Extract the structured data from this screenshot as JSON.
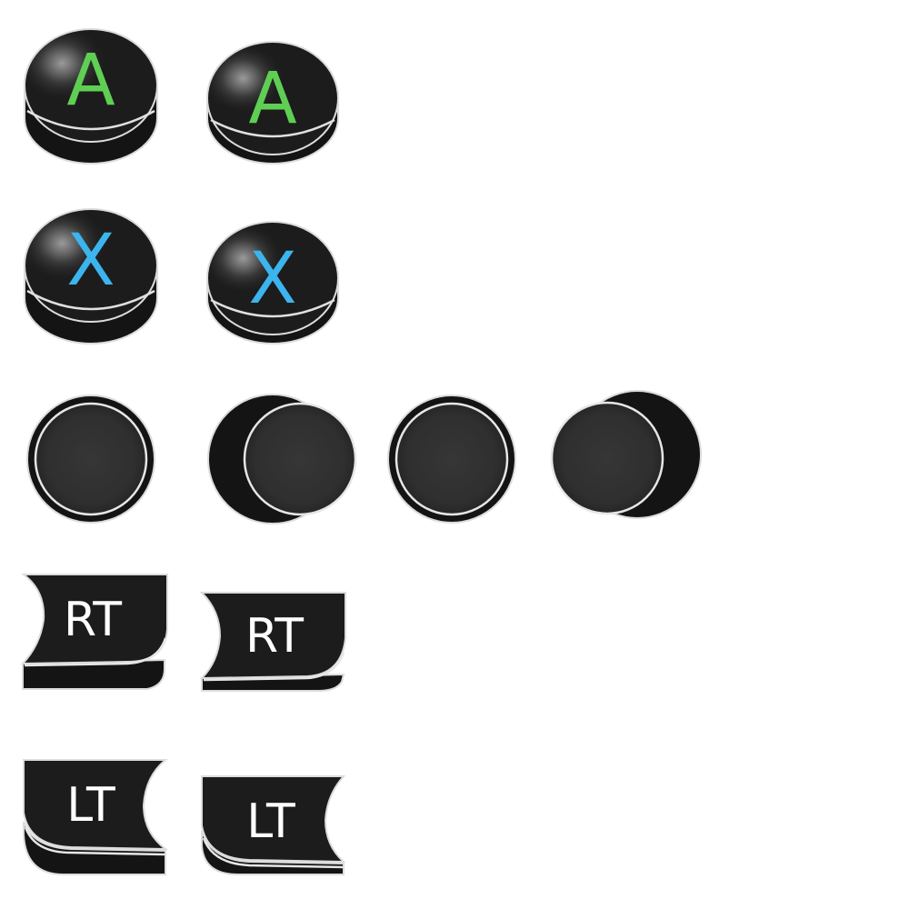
{
  "colors": {
    "background": "#ffffff",
    "button_body": "#141414",
    "button_top": "#1c1c1c",
    "edge_highlight": "#d8d8d8",
    "stick_cap": "#333333",
    "a_label": "#5fcf54",
    "x_label": "#3cb4ee",
    "trigger_label": "#ffffff"
  },
  "face_buttons": {
    "a_normal": {
      "label": "A",
      "icon": "a-button-icon",
      "state": "normal"
    },
    "a_pressed": {
      "label": "A",
      "icon": "a-button-icon",
      "state": "pressed"
    },
    "x_normal": {
      "label": "X",
      "icon": "x-button-icon",
      "state": "normal"
    },
    "x_pressed": {
      "label": "X",
      "icon": "x-button-icon",
      "state": "pressed"
    }
  },
  "thumbsticks": [
    {
      "icon": "thumbstick-icon",
      "state": "center"
    },
    {
      "icon": "thumbstick-icon",
      "state": "right"
    },
    {
      "icon": "thumbstick-icon",
      "state": "center"
    },
    {
      "icon": "thumbstick-icon",
      "state": "left"
    }
  ],
  "triggers": {
    "rt_normal": {
      "label": "RT",
      "icon": "right-trigger-icon",
      "state": "normal"
    },
    "rt_pressed": {
      "label": "RT",
      "icon": "right-trigger-icon",
      "state": "pressed"
    },
    "lt_normal": {
      "label": "LT",
      "icon": "left-trigger-icon",
      "state": "normal"
    },
    "lt_pressed": {
      "label": "LT",
      "icon": "left-trigger-icon",
      "state": "pressed"
    }
  }
}
